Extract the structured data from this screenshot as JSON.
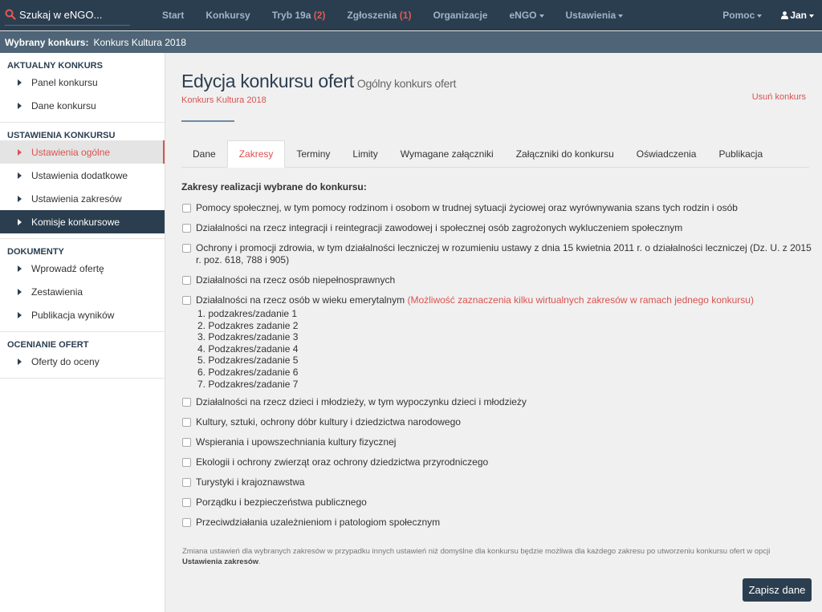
{
  "topbar": {
    "search_label": "Szukaj w eNGO...",
    "nav": [
      {
        "label": "Start",
        "count": ""
      },
      {
        "label": "Konkursy",
        "count": ""
      },
      {
        "label": "Tryb 19a",
        "count": "(2)"
      },
      {
        "label": "Zgłoszenia",
        "count": "(1)"
      },
      {
        "label": "Organizacje",
        "count": ""
      },
      {
        "label": "eNGO",
        "count": ""
      },
      {
        "label": "Ustawienia",
        "count": ""
      }
    ],
    "help_label": "Pomoc",
    "user_label": "Jan"
  },
  "contest_bar": {
    "label": "Wybrany konkurs:",
    "value": "Konkurs Kultura 2018"
  },
  "sidebar": {
    "sections": [
      {
        "title": "AKTUALNY KONKURS",
        "items": [
          "Panel konkursu",
          "Dane konkursu"
        ]
      },
      {
        "title": "USTAWIENIA KONKURSU",
        "items": [
          "Ustawienia ogólne",
          "Ustawienia dodatkowe",
          "Ustawienia zakresów",
          "Komisje konkursowe"
        ]
      },
      {
        "title": "DOKUMENTY",
        "items": [
          "Wprowadź ofertę",
          "Zestawienia",
          "Publikacja wyników"
        ]
      },
      {
        "title": "OCENIANIE OFERT",
        "items": [
          "Oferty do oceny"
        ]
      }
    ]
  },
  "main": {
    "title": "Edycja konkursu ofert",
    "title_sub": "Ogólny konkurs ofert",
    "subtitle": "Konkurs Kultura 2018",
    "delete_label": "Usuń konkurs",
    "tabs": [
      "Dane",
      "Zakresy",
      "Terminy",
      "Limity",
      "Wymagane załączniki",
      "Załączniki do konkursu",
      "Oświadczenia",
      "Publikacja"
    ],
    "section_label": "Zakresy realizacji wybrane do konkursu:",
    "scopes": [
      "Pomocy społecznej, w tym pomocy rodzinom i osobom w trudnej sytuacji życiowej oraz wyrównywania szans tych rodzin i osób",
      "Działalności na rzecz integracji i reintegracji zawodowej i społecznej osób zagrożonych wykluczeniem społecznym",
      "Ochrony i promocji zdrowia, w tym działalności leczniczej w rozumieniu ustawy z dnia 15 kwietnia 2011 r. o działalności leczniczej (Dz. U. z 2015 r. poz. 618, 788 i 905)",
      "Działalności na rzecz osób niepełnosprawnych",
      "Działalności na rzecz osób w wieku emerytalnym",
      "Działalności na rzecz dzieci i młodzieży, w tym wypoczynku dzieci i młodzieży",
      "Kultury, sztuki, ochrony dóbr kultury i dziedzictwa narodowego",
      "Wspierania i upowszechniania kultury fizycznej",
      "Ekologii i ochrony zwierząt oraz ochrony dziedzictwa przyrodniczego",
      "Turystyki i krajoznawstwa",
      "Porządku i bezpieczeństwa publicznego",
      "Przeciwdziałania uzależnieniom i patologiom społecznym"
    ],
    "scope_note": "(Możliwość zaznaczenia kilku wirtualnych zakresów w ramach jednego konkursu)",
    "subtasks": [
      "1. podzakres/zadanie 1",
      "2. Podzakres zadanie 2",
      "3. Podzakres/zadanie 3",
      "4. Podzakres/zadanie 4",
      "5. Podzakres/zadanie 5",
      "6. Podzakres/zadanie 6",
      "7. Podzakres/zadanie 7"
    ],
    "footnote_text": "Zmiana ustawień dla wybranych zakresów w przypadku innych ustawień niż domyślne dla konkursu będzie możliwa dla każdego zakresu po utworzeniu konkursu ofert w opcji",
    "footnote_link": "Ustawienia zakresów",
    "footnote_end": ".",
    "save_label": "Zapisz dane"
  },
  "colors": {
    "navbar": "#2b3e50",
    "accent": "#d9534f",
    "contest_bar": "#4f6577"
  }
}
